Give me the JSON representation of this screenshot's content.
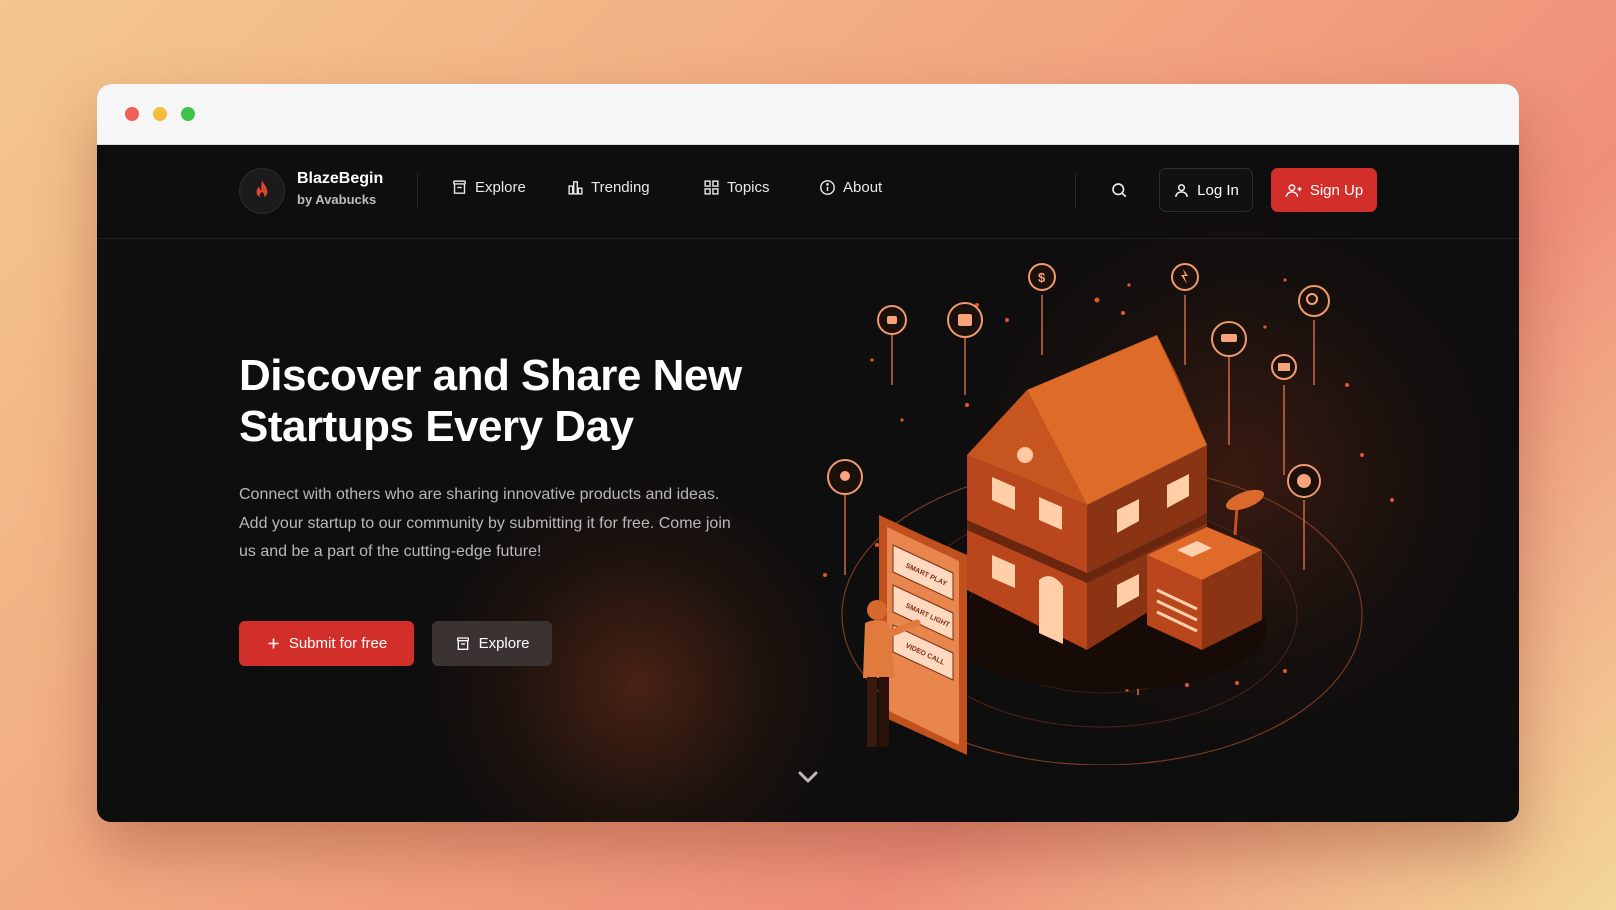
{
  "brand": {
    "name": "BlazeBegin",
    "subtitle": "by Avabucks",
    "logo_icon": "flame-icon",
    "accent_color": "#d32f2a"
  },
  "nav": {
    "links": [
      {
        "label": "Explore",
        "icon": "archive-box-icon"
      },
      {
        "label": "Trending",
        "icon": "bar-chart-icon"
      },
      {
        "label": "Topics",
        "icon": "grid-icon"
      },
      {
        "label": "About",
        "icon": "info-circle-icon"
      }
    ],
    "search_icon": "search-icon",
    "login_label": "Log In",
    "signup_label": "Sign Up"
  },
  "hero": {
    "title_line1": "Discover and Share New",
    "title_line2": "Startups Every Day",
    "description": "Connect with others who are sharing innovative products and ideas. Add your startup to our community by submitting it for free. Come join us and be a part of the cutting-edge future!",
    "primary_button": "Submit for free",
    "secondary_button": "Explore"
  },
  "illustration": {
    "phone_items": [
      "SMART PLAY",
      "SMART LIGHT",
      "VIDEO CALL"
    ]
  },
  "scroll_indicator": "chevron-down-icon"
}
